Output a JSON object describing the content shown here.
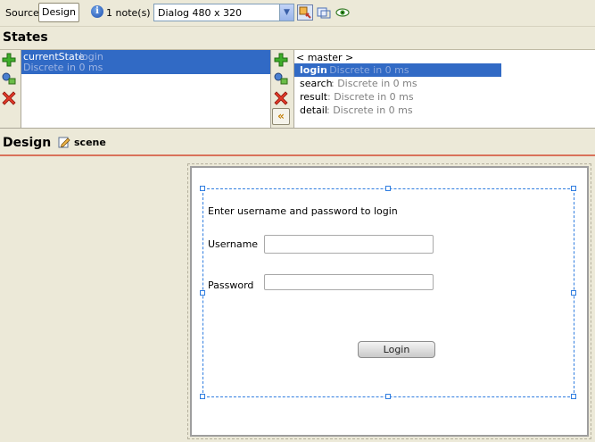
{
  "toolbar": {
    "source_label": "Source",
    "design_label": "Design",
    "info_glyph": "i",
    "notes_text": "1 note(s)",
    "device_value": "Dialog 480 x 320",
    "icons": [
      "property-icon",
      "frame-icon",
      "preview-eye-icon"
    ]
  },
  "states": {
    "title": "States",
    "current": {
      "name": "currentState",
      "value": "login",
      "desc": "Discrete in 0 ms"
    },
    "master_label": "< master >",
    "list": [
      {
        "name": "login",
        "desc": ": Discrete in 0 ms",
        "selected": true
      },
      {
        "name": "search",
        "desc": ": Discrete in 0 ms",
        "selected": false
      },
      {
        "name": "result",
        "desc": ": Discrete in 0 ms",
        "selected": false
      },
      {
        "name": "detail",
        "desc": ": Discrete in 0 ms",
        "selected": false
      }
    ],
    "move_left_glyph": "«"
  },
  "design": {
    "title": "Design",
    "scene_label": "scene"
  },
  "form": {
    "heading": "Enter username and password to login",
    "username_label": "Username",
    "password_label": "Password",
    "username_value": "",
    "password_value": "",
    "login_label": "Login"
  },
  "colors": {
    "selection": "#316ac5",
    "design_rule": "#d9725a",
    "handles": "#2f7de0"
  }
}
